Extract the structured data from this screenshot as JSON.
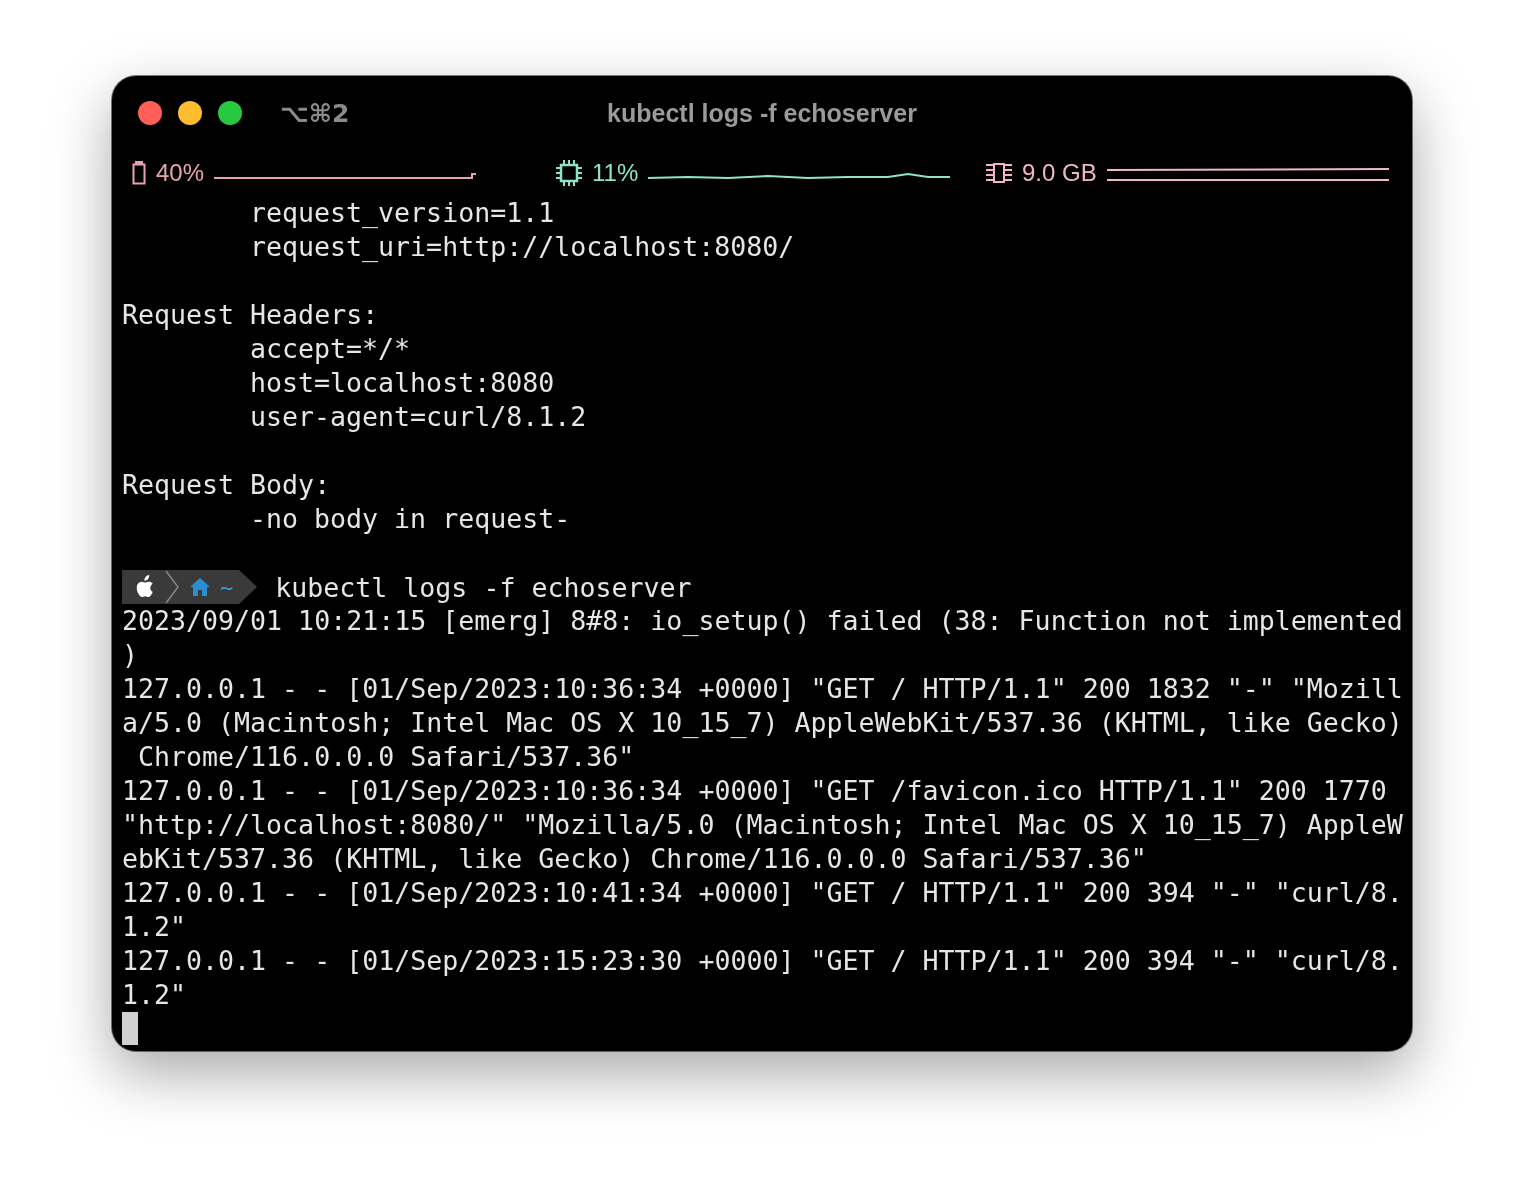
{
  "window": {
    "title": "kubectl logs -f echoserver",
    "shortcut": "⌥⌘2"
  },
  "status_bar": [
    {
      "kind": "battery",
      "value": "40%",
      "color": "#e8a3ae"
    },
    {
      "kind": "cpu",
      "value": "11%",
      "color": "#8fe3c8"
    },
    {
      "kind": "memory",
      "value": "9.0 GB",
      "color": "#f2b5cc"
    }
  ],
  "output_before": [
    {
      "kind": "indented",
      "text": "request_version=1.1"
    },
    {
      "kind": "indented",
      "text": "request_uri=http://localhost:8080/"
    },
    {
      "kind": "blank"
    },
    {
      "kind": "plain",
      "text": "Request Headers:"
    },
    {
      "kind": "indented",
      "text": "accept=*/*"
    },
    {
      "kind": "indented",
      "text": "host=localhost:8080"
    },
    {
      "kind": "indented",
      "text": "user-agent=curl/8.1.2"
    },
    {
      "kind": "blank"
    },
    {
      "kind": "plain",
      "text": "Request Body:"
    },
    {
      "kind": "indented",
      "text": "-no body in request-"
    },
    {
      "kind": "blank"
    }
  ],
  "prompt": {
    "directory": "~",
    "command": "kubectl logs -f echoserver"
  },
  "output_after": [
    {
      "kind": "plain",
      "text": "2023/09/01 10:21:15 [emerg] 8#8: io_setup() failed (38: Function not implemented"
    },
    {
      "kind": "plain",
      "text": ")"
    },
    {
      "kind": "plain",
      "text": "127.0.0.1 - - [01/Sep/2023:10:36:34 +0000] \"GET / HTTP/1.1\" 200 1832 \"-\" \"Mozill"
    },
    {
      "kind": "plain",
      "text": "a/5.0 (Macintosh; Intel Mac OS X 10_15_7) AppleWebKit/537.36 (KHTML, like Gecko)"
    },
    {
      "kind": "plain",
      "text": " Chrome/116.0.0.0 Safari/537.36\""
    },
    {
      "kind": "plain",
      "text": "127.0.0.1 - - [01/Sep/2023:10:36:34 +0000] \"GET /favicon.ico HTTP/1.1\" 200 1770"
    },
    {
      "kind": "plain",
      "text": "\"http://localhost:8080/\" \"Mozilla/5.0 (Macintosh; Intel Mac OS X 10_15_7) AppleW"
    },
    {
      "kind": "plain",
      "text": "ebKit/537.36 (KHTML, like Gecko) Chrome/116.0.0.0 Safari/537.36\""
    },
    {
      "kind": "plain",
      "text": "127.0.0.1 - - [01/Sep/2023:10:41:34 +0000] \"GET / HTTP/1.1\" 200 394 \"-\" \"curl/8."
    },
    {
      "kind": "plain",
      "text": "1.2\""
    },
    {
      "kind": "plain",
      "text": "127.0.0.1 - - [01/Sep/2023:15:23:30 +0000] \"GET / HTTP/1.1\" 200 394 \"-\" \"curl/8."
    },
    {
      "kind": "plain",
      "text": "1.2\""
    }
  ]
}
